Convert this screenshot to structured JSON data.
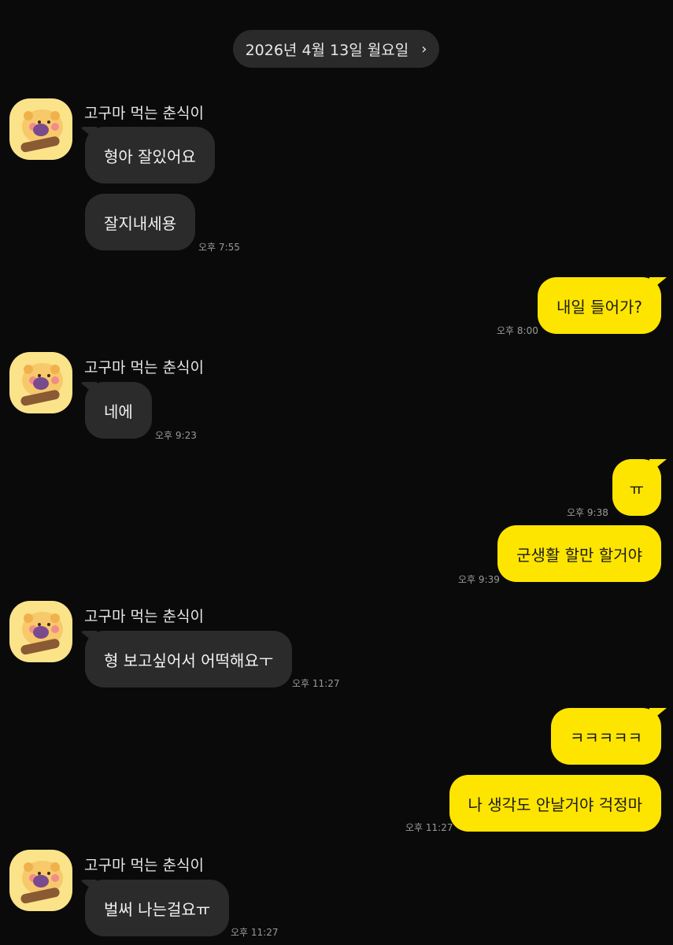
{
  "date_header": {
    "label": "2026년 4월 13일 월요일",
    "chevron": "›"
  },
  "contact": {
    "name": "고구마 먹는 춘식이",
    "avatar_icon": "chunsik-sweet-potato-avatar"
  },
  "messages": [
    {
      "text": "형아 잘있어요",
      "time": ""
    },
    {
      "text": "잘지내세용",
      "time": "오후 7:55"
    },
    {
      "text": "내일 들어가?",
      "time": "오후 8:00"
    },
    {
      "text": "네에",
      "time": "오후 9:23"
    },
    {
      "text": "ㅠ",
      "time": "오후 9:38"
    },
    {
      "text": "군생활 할만 할거야",
      "time": "오후 9:39"
    },
    {
      "text": "형 보고싶어서 어떡해요ㅜ",
      "time": "오후 11:27"
    },
    {
      "text": "ㅋㅋㅋㅋㅋ",
      "time": ""
    },
    {
      "text": "나 생각도 안날거야 걱정마",
      "time": "오후 11:27"
    },
    {
      "text": "벌써 나는걸요ㅠ",
      "time": "오후 11:27"
    }
  ],
  "colors": {
    "background": "#0a0a0a",
    "incoming": "#2b2b2b",
    "outgoing": "#fee500"
  }
}
